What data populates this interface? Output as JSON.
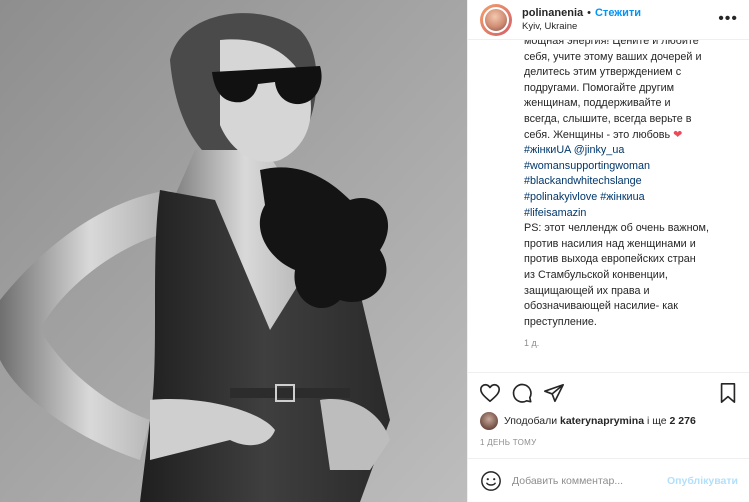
{
  "header": {
    "username": "polinanenia",
    "separator": "•",
    "follow_label": "Стежити",
    "location": "Kyiv, Ukraine",
    "more_icon": "ellipsis-icon"
  },
  "caption": {
    "lines": [
      "мощная энергия! Цените и любите",
      "себя, учите этому ваших дочерей и",
      "делитесь этим утверждением с",
      "подругами. Помогайте другим",
      "женщинам, поддерживайте и",
      "всегда, слышите, всегда верьте в"
    ],
    "love_line": "себя. Женщины - это любовь",
    "heart": "❤",
    "tags_line1_a": "#жінкиUA",
    "tags_line1_b": "@jinky_ua",
    "tag2": "#womansupportingwoman",
    "tag3": "#blackandwhitechslange",
    "tags_line4_a": "#polinakyivlove",
    "tags_line4_b": "#жінкиua",
    "tag5": "#lifeisamazin",
    "ps_lines": [
      "PS: этот челлендж об очень важном,",
      "против насилия над женщинами и",
      "против выхода европейских стран",
      "из Стамбульской конвенции,",
      "защищающей их права и",
      "обозначивающей насилие- как",
      "преступление."
    ],
    "time_ago": "1 д."
  },
  "actions": {
    "like_icon": "heart-icon",
    "comment_icon": "comment-icon",
    "share_icon": "share-icon",
    "save_icon": "bookmark-icon"
  },
  "likes": {
    "prefix": "Уподобали",
    "user": "katerynaprymina",
    "middle": "і ще",
    "count": "2 276"
  },
  "date": "1 ДЕНЬ ТОМУ",
  "comment": {
    "placeholder": "Добавить комментар...",
    "publish_label": "Опублікувати"
  },
  "colors": {
    "accent": "#0095f6",
    "hashtag": "#00376b",
    "heart": "#ed4956",
    "muted": "#8e8e8e",
    "publish_disabled": "#b2dffc"
  }
}
